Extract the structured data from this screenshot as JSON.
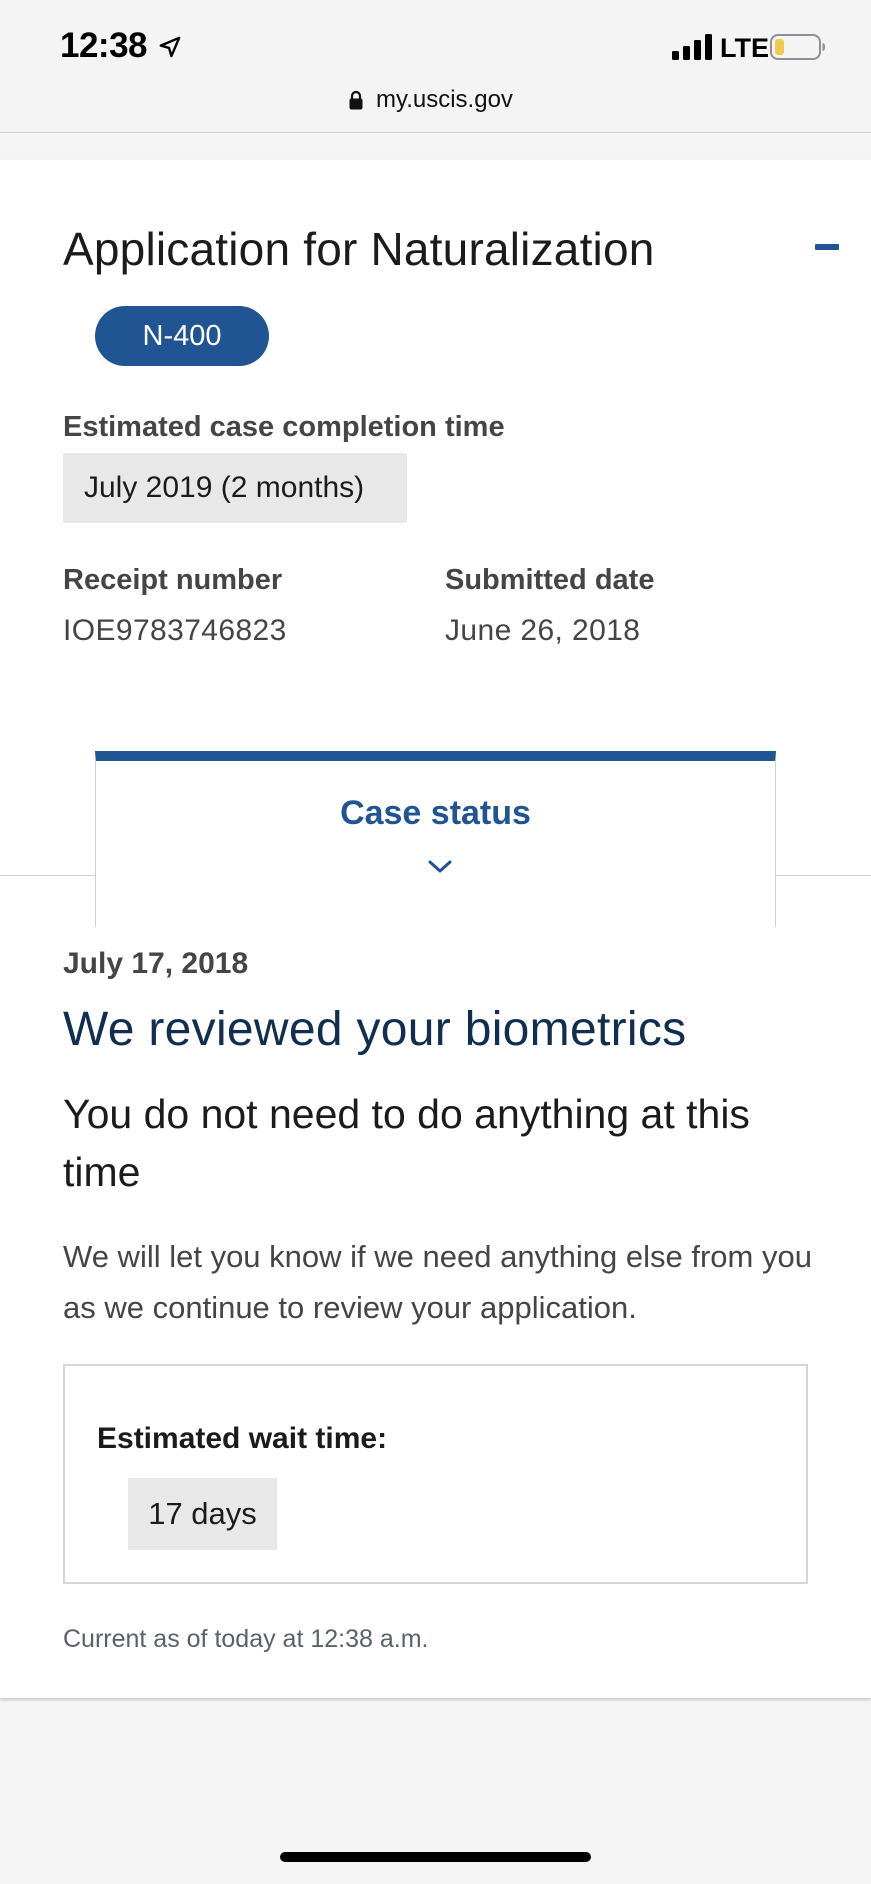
{
  "status_bar": {
    "time": "12:38",
    "network": "LTE",
    "battery_color": "#f2c94c"
  },
  "browser": {
    "url": "my.uscis.gov"
  },
  "application": {
    "title": "Application for Naturalization",
    "form_badge": "N-400",
    "estimated_completion_label": "Estimated case completion time",
    "estimated_completion_value": "July 2019 (2 months)",
    "receipt_label": "Receipt number",
    "receipt_value": "IOE9783746823",
    "submitted_label": "Submitted date",
    "submitted_value": "June 26, 2018"
  },
  "case_status": {
    "tab_label": "Case status",
    "date": "July 17, 2018",
    "heading": "We reviewed your biometrics",
    "subheading": "You do not need to do anything at this time",
    "body": "We will let you know if we need anything else from you as we continue to review your application.",
    "wait_label": "Estimated wait time:",
    "wait_value": "17 days",
    "current_note": "Current as of today at 12:38 a.m."
  },
  "colors": {
    "primary": "#205493",
    "heading_dark": "#112e51",
    "gray_text": "#454545",
    "gray_fill": "#e8e8e8"
  },
  "icons": {
    "location": "location-arrow-icon",
    "signal": "cellular-signal-icon",
    "battery": "battery-icon",
    "lock": "lock-icon",
    "collapse": "minus-icon",
    "chevron": "chevron-down-icon"
  }
}
